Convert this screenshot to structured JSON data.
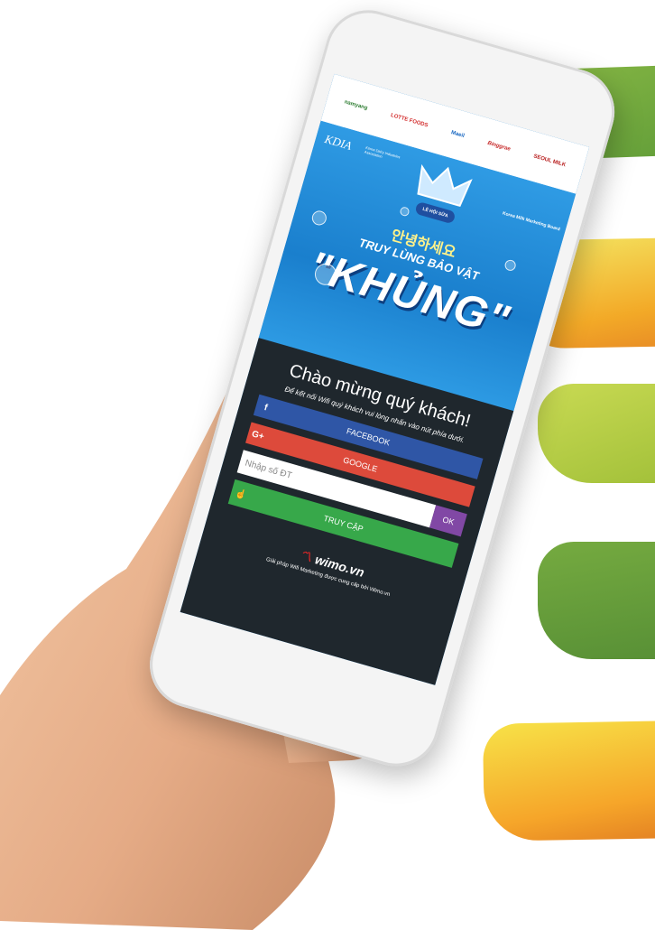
{
  "sponsors": [
    "namyang",
    "LOTTE FOODS",
    "Maeil",
    "Binggrae",
    "SEOUL MILK"
  ],
  "hero": {
    "org_short": "KDIA",
    "org_full": "Korea Dairy Industries Association",
    "board": "Korea Milk Marketing Board",
    "badge": "LỄ HỘI SỮA",
    "greeting": "안녕하세요",
    "headline": "TRUY LÙNG BẢO VẬT",
    "highlight": "\"KHỦNG\""
  },
  "login": {
    "welcome": "Chào mừng quý khách!",
    "instruction": "Để kết nối Wifi quý khách vui lòng nhấn vào nút phía dưới.",
    "facebook_label": "FACEBOOK",
    "google_label": "GOOGLE",
    "phone_placeholder": "Nhập số ĐT",
    "ok_label": "OK",
    "access_label": "TRUY CẬP"
  },
  "brand": {
    "name": "wimo.vn",
    "footer": "Giải pháp Wifi Marketing được cung cấp bởi Wimo.vn"
  },
  "colors": {
    "facebook": "#2f56a6",
    "google": "#dd4a3b",
    "ok": "#8148a5",
    "access": "#37a84a",
    "overlay": "#1e1e1e",
    "hero_blue": "#2f9be4"
  },
  "icons": [
    "facebook-icon",
    "google-plus-icon",
    "hand-pointer-icon",
    "wimo-logo-icon"
  ]
}
